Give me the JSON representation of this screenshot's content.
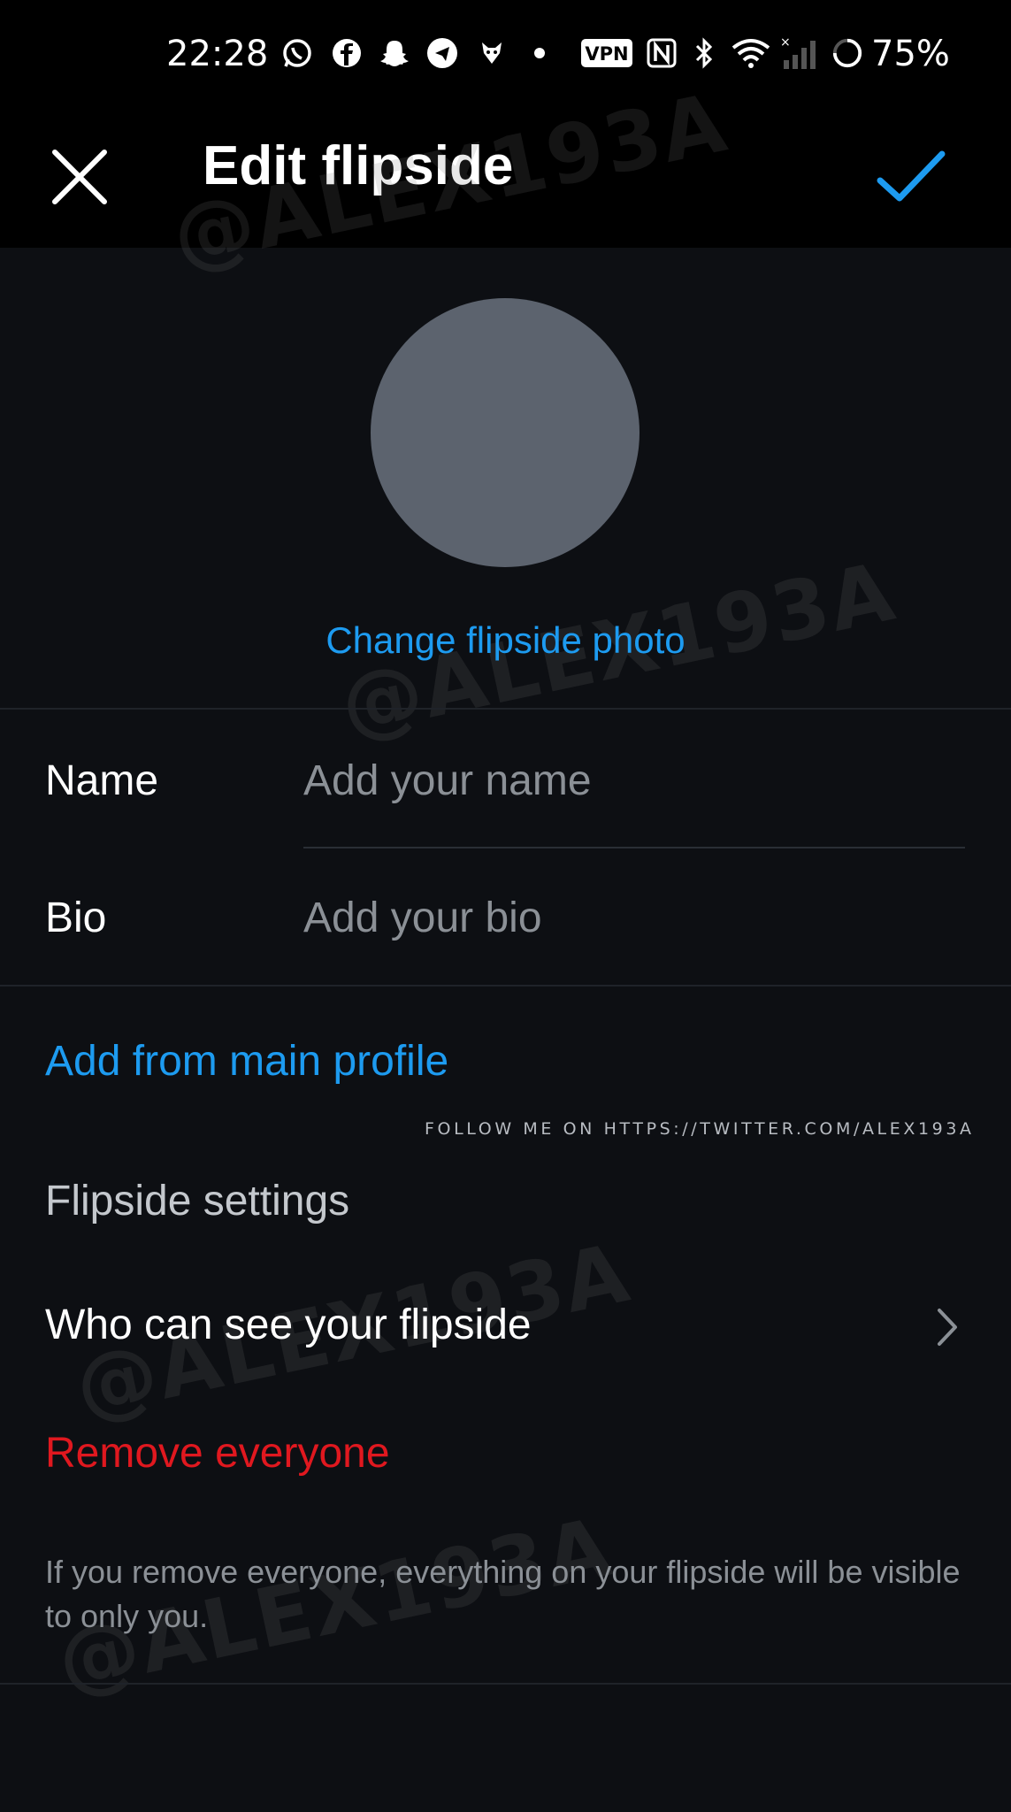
{
  "status_bar": {
    "time": "22:28",
    "battery_percent": "75%",
    "vpn": "VPN",
    "icons": [
      "whatsapp-icon",
      "facebook-icon",
      "snapchat-icon",
      "telegram-icon",
      "fox-icon",
      "dot-icon",
      "vpn-icon",
      "nfc-icon",
      "bluetooth-icon",
      "wifi-icon",
      "signal-icon",
      "battery-icon"
    ]
  },
  "header": {
    "title": "Edit flipside",
    "close_icon": "close-icon",
    "done_icon": "check-icon",
    "accent_color": "#1d9bf0"
  },
  "photo": {
    "change_label": "Change flipside photo"
  },
  "form": {
    "name_label": "Name",
    "name_placeholder": "Add your name",
    "bio_label": "Bio",
    "bio_placeholder": "Add your bio"
  },
  "add_from_main": "Add from main profile",
  "follow_note": "FOLLOW ME ON HTTPS://TWITTER.COM/ALEX193A",
  "settings": {
    "heading": "Flipside settings",
    "who_can_see": "Who can see your flipside",
    "remove_everyone": "Remove everyone",
    "remove_color": "#e0181f",
    "hint": "If you remove everyone, everything on your flipside will be visible to only you."
  },
  "watermark": "@ALEX193A"
}
